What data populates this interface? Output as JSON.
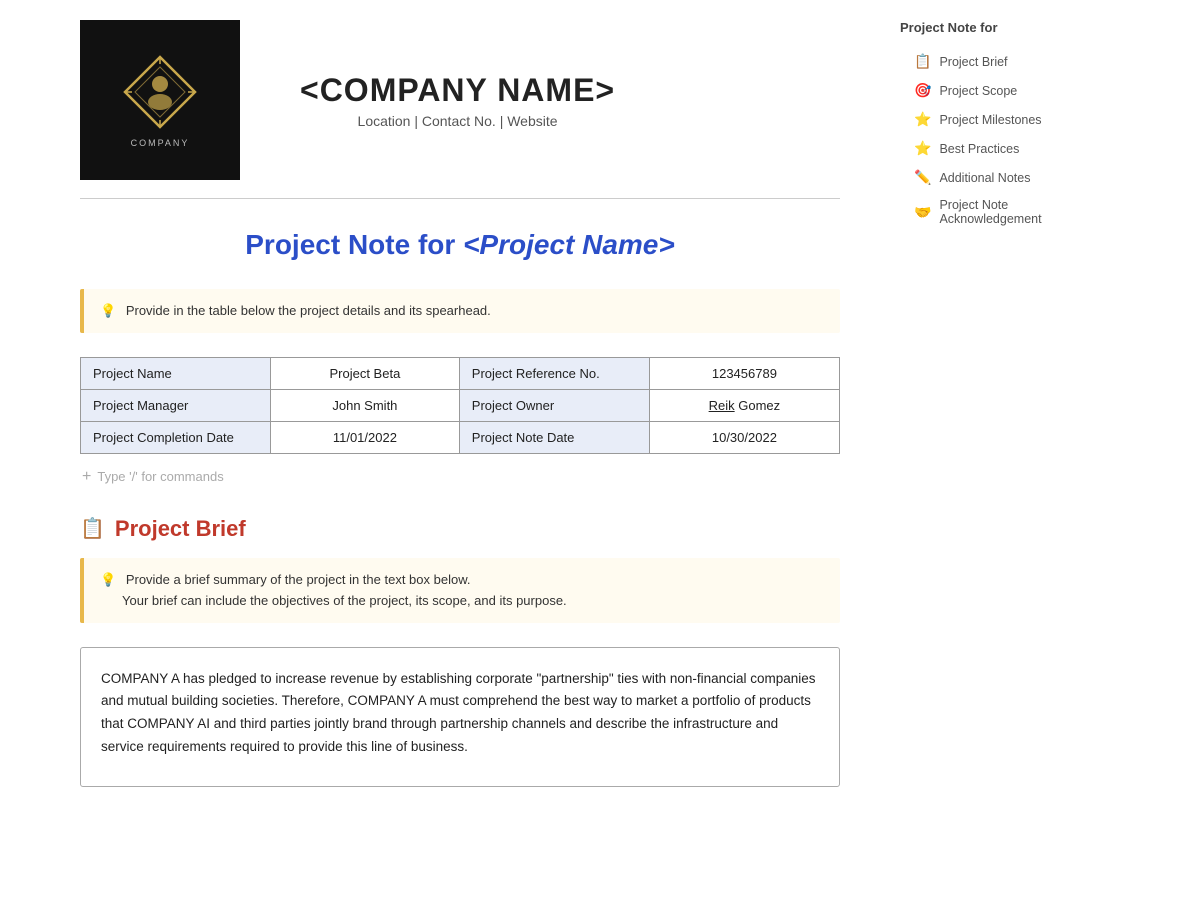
{
  "header": {
    "company_name": "<COMPANY NAME>",
    "company_sub": "Location | Contact No. | Website",
    "company_label": "COMPANY"
  },
  "page_title": {
    "static_part": "Project Note for ",
    "italic_part": "<Project Name>"
  },
  "info_box_1": {
    "text": "Provide in the table below the project details and its spearhead."
  },
  "project_table": {
    "rows": [
      {
        "col1": "Project Name",
        "col2": "Project Beta",
        "col3": "Project Reference No.",
        "col4": "123456789"
      },
      {
        "col1": "Project Manager",
        "col2": "John Smith",
        "col3": "Project Owner",
        "col4": "Reik Gomez",
        "col4_underline": "Reik"
      },
      {
        "col1": "Project Completion Date",
        "col2": "11/01/2022",
        "col3": "Project Note Date",
        "col4": "10/30/2022"
      }
    ]
  },
  "command_placeholder": "Type '/' for commands",
  "sections": [
    {
      "id": "project-brief",
      "title": "Project Brief",
      "icon": "📋",
      "info_box": {
        "line1": "Provide a brief summary of the project in the text box below.",
        "line2": "Your brief can include the objectives of the project, its scope, and its purpose."
      },
      "content": "COMPANY A has pledged to increase revenue by establishing corporate \"partnership\" ties with non-financial companies and mutual building societies. Therefore, COMPANY A must comprehend the best way to market a portfolio of products that COMPANY AI and third parties jointly brand through partnership channels and describe the infrastructure and service requirements required to provide this line of business."
    }
  ],
  "sidebar": {
    "title": "Project Note for",
    "items": [
      {
        "label": "Project Brief",
        "icon": "📋",
        "color": "#888"
      },
      {
        "label": "Project Scope",
        "icon": "🎯",
        "color": "#e05"
      },
      {
        "label": "Project Milestones",
        "icon": "⭐",
        "color": "#f90"
      },
      {
        "label": "Best Practices",
        "icon": "⭐",
        "color": "#f90"
      },
      {
        "label": "Additional Notes",
        "icon": "✏️",
        "color": "#c84"
      },
      {
        "label": "Project Note Acknowledgement",
        "icon": "🤝",
        "color": "#f90"
      }
    ]
  }
}
